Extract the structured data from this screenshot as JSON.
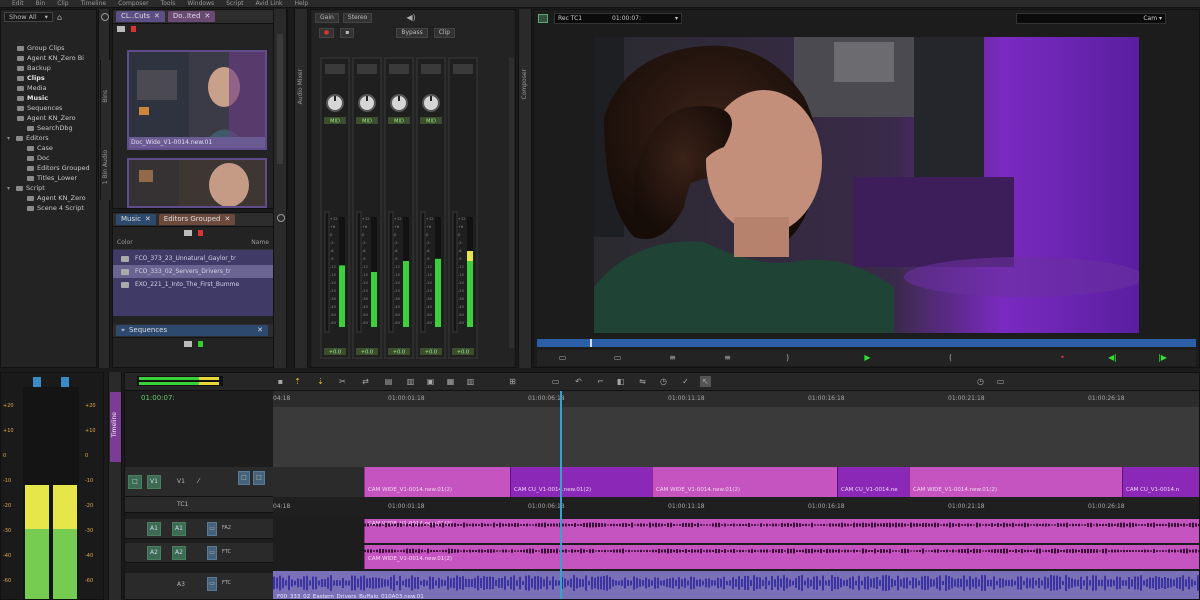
{
  "menu": [
    "Edit",
    "Bin",
    "Clip",
    "Timeline",
    "Composer",
    "Tools",
    "Windows",
    "Script",
    "Avid Link",
    "Help"
  ],
  "project": {
    "filter_label": "Show All",
    "items": [
      {
        "label": "Group Clips",
        "bold": false,
        "indent": 1
      },
      {
        "label": "Agent KN_Zero Bi",
        "bold": false,
        "indent": 1
      },
      {
        "label": "Backup",
        "bold": false,
        "indent": 1
      },
      {
        "label": "Clips",
        "bold": true,
        "indent": 1
      },
      {
        "label": "Media",
        "bold": false,
        "indent": 1
      },
      {
        "label": "Music",
        "bold": true,
        "indent": 1
      },
      {
        "label": "Sequences",
        "bold": false,
        "indent": 1
      },
      {
        "label": "Agent KN_Zero",
        "bold": false,
        "indent": 1
      },
      {
        "label": "SearchDbg",
        "bold": false,
        "indent": 2
      },
      {
        "label": "Editors",
        "bold": false,
        "indent": 0
      },
      {
        "label": "Case",
        "bold": false,
        "indent": 2
      },
      {
        "label": "Doc",
        "bold": false,
        "indent": 2
      },
      {
        "label": "Editors Grouped",
        "bold": false,
        "indent": 2
      },
      {
        "label": "Titles_Lower",
        "bold": false,
        "indent": 2
      },
      {
        "label": "Script",
        "bold": false,
        "indent": 0
      },
      {
        "label": "Agent KN_Zero",
        "bold": false,
        "indent": 2
      },
      {
        "label": "Scene 4 Script",
        "bold": false,
        "indent": 2
      }
    ]
  },
  "bins_top": {
    "tabs": [
      "CL..Cuts",
      "Do..Ited"
    ],
    "frames": [
      {
        "caption": "Doc_Wide_V1-0014.new.01"
      },
      {
        "caption": ""
      }
    ],
    "side_label_1": "Bins",
    "side_label_2": "1 Bin Audio"
  },
  "bins_bottom": {
    "tabs": [
      "Music",
      "Editors Grouped"
    ],
    "col_left": "Color",
    "col_right": "Name",
    "rows": [
      {
        "label": "FCO_373_23_Unnatural_Gaylor_tr"
      },
      {
        "label": "FCO_333_02_Servers_Drivers_tr"
      },
      {
        "label": "EXO_221_1_Into_The_First_Bumme"
      }
    ],
    "sequences_tab": "Sequences"
  },
  "mixer": {
    "buttons": [
      "Gain",
      "Stereo"
    ],
    "row2_buttons": [
      "Bypass",
      "Clip"
    ],
    "side_label": "Audio Mixer",
    "strip_pan_labels": [
      "MID",
      "MID",
      "MID",
      "MID"
    ],
    "strip_vol_labels": [
      "+0.0",
      "+0.0",
      "+0.0",
      "+0.0",
      "+0.0"
    ],
    "meter_levels": [
      0.56,
      0.5,
      0.6,
      0.62,
      0.6
    ],
    "scale": [
      "+12",
      "+6",
      "0",
      "-3",
      "-6",
      "-9",
      "-12",
      "-15",
      "-20",
      "-25",
      "-30",
      "-40",
      "-50",
      "-60"
    ]
  },
  "composer": {
    "source_label": "Rec TC1",
    "source_tc": "01:00:07:",
    "right_label": "Cam",
    "side_label": "Composer",
    "position_fraction": 0.08
  },
  "timeline": {
    "meter_top_labels": [
      "+20",
      "+10",
      "0",
      "-10",
      "-20",
      "-30",
      "-50"
    ],
    "timecode": "01:00:07:",
    "ruler": [
      "04:18",
      "01:00:01:18",
      "01:00:06:18",
      "01:00:11:18",
      "01:00:16:18",
      "01:00:21:18",
      "01:00:26:18"
    ],
    "sub_ruler": [
      "04:18",
      "01:00:01:18",
      "01:00:06:18",
      "01:00:11:18",
      "01:00:16:18",
      "01:00:21:18",
      "01:00:26:18"
    ],
    "track_labels": {
      "v1": "V1",
      "tc1": "TC1",
      "a1": "A1",
      "a2": "A2",
      "a3": "A3"
    },
    "audio_track_readouts": [
      "FA2",
      "FTC",
      "FTC"
    ],
    "video_clips": [
      {
        "label": "CAM WIDE_V1-0014.new.01(2)",
        "color": "pink"
      },
      {
        "label": "CAM CU_V1-0014.new.01(2)",
        "color": "violet"
      },
      {
        "label": "CAM WIDE_V1-0014.new.01(2)",
        "color": "pink"
      },
      {
        "label": "CAM CU_V1-0014.ne",
        "color": "violet"
      },
      {
        "label": "CAM WIDE_V1-0014.new.01(2)",
        "color": "pink"
      },
      {
        "label": "CAM CU_V1-0014.n",
        "color": "violet"
      }
    ],
    "audio_clip_label_1": "CAM WIDE_V1-0014.new.01(2)",
    "audio_clip_label_2": "CAM WIDE_V1-0014.new.01(2)",
    "music_clip_label": "F00_333_02_Eastern_Drivers_Buffalo_010A03.new.01",
    "side_label": "Timeline",
    "left_meter_scale": [
      "+20",
      "+10",
      "0",
      "-10",
      "-20",
      "-30",
      "-40",
      "-60"
    ]
  },
  "colors": {
    "accent_purple": "#5f4c8a",
    "clip_pink": "#c654c0",
    "clip_violet": "#8c28b8",
    "meter_green": "#3ad13a",
    "meter_yellow": "#e6e64a",
    "playhead": "#3aa0c8",
    "position_bar": "#3a76c2"
  }
}
